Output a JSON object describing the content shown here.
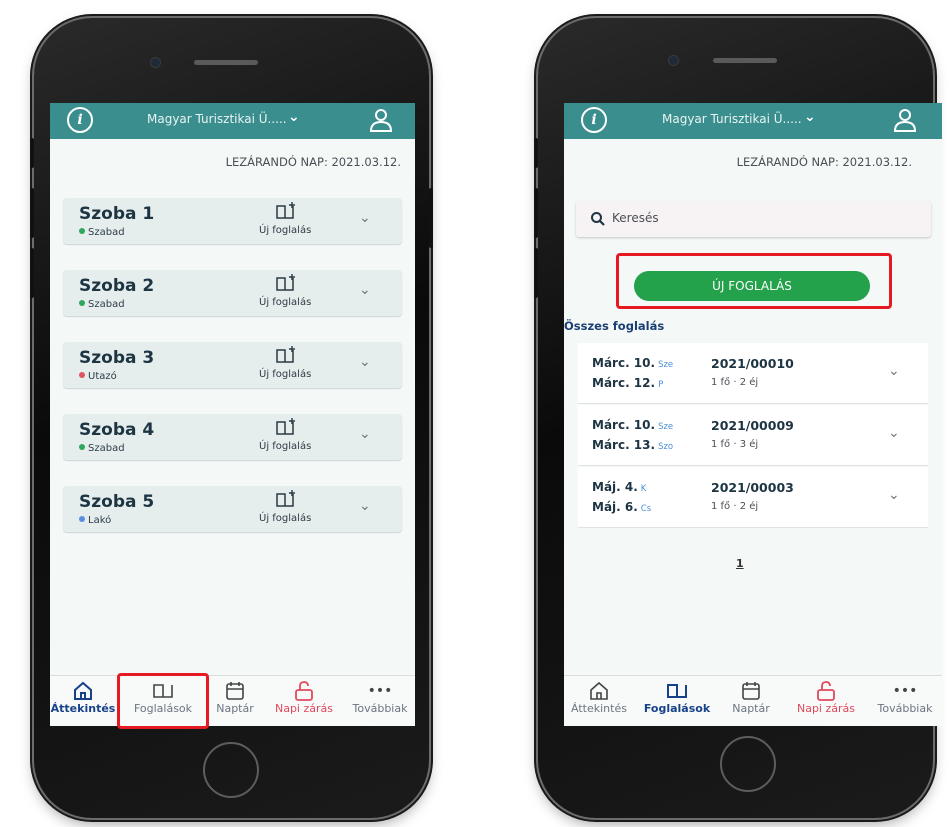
{
  "left": {
    "topbar": {
      "title": "Magyar Turisztikai Ü....."
    },
    "close_date": "LEZÁRANDÓ NAP: 2021.03.12.",
    "rooms": [
      {
        "name": "Szoba 1",
        "status": "Szabad",
        "status_color": "#2fa65a",
        "new_booking": "Új foglalás"
      },
      {
        "name": "Szoba 2",
        "status": "Szabad",
        "status_color": "#2fa65a",
        "new_booking": "Új foglalás"
      },
      {
        "name": "Szoba 3",
        "status": "Utazó",
        "status_color": "#e0555f",
        "new_booking": "Új foglalás"
      },
      {
        "name": "Szoba 4",
        "status": "Szabad",
        "status_color": "#2fa65a",
        "new_booking": "Új foglalás"
      },
      {
        "name": "Szoba 5",
        "status": "Lakó",
        "status_color": "#5a8fe0",
        "new_booking": "Új foglalás"
      }
    ],
    "nav": [
      "Áttekintés",
      "Foglalások",
      "Naptár",
      "Napi zárás",
      "Továbbiak"
    ]
  },
  "right": {
    "topbar": {
      "title": "Magyar Turisztikai Ü....."
    },
    "close_date": "LEZÁRANDÓ NAP: 2021.03.12.",
    "search_placeholder": "Keresés",
    "new_booking_button": "ÚJ FOGLALÁS",
    "all_bookings_label": "Összes foglalás",
    "bookings": [
      {
        "from": "Márc. 10.",
        "from_day": "Sze",
        "to": "Márc. 12.",
        "to_day": "P",
        "number": "2021/00010",
        "meta": "1 fő · 2 éj"
      },
      {
        "from": "Márc. 10.",
        "from_day": "Sze",
        "to": "Márc. 13.",
        "to_day": "Szo",
        "number": "2021/00009",
        "meta": "1 fő · 3 éj"
      },
      {
        "from": "Máj. 4.",
        "from_day": "K",
        "to": "Máj. 6.",
        "to_day": "Cs",
        "number": "2021/00003",
        "meta": "1 fő · 2 éj"
      }
    ],
    "page": "1",
    "nav": [
      "Áttekintés",
      "Foglalások",
      "Naptár",
      "Napi zárás",
      "Továbbiak"
    ]
  },
  "colors": {
    "topbar": "#3b8e8e",
    "accent_green": "#23a14b",
    "highlight_red": "#e51a22",
    "active_nav": "#17428a",
    "danger": "#df4a5c"
  },
  "icons": [
    "info-icon",
    "chevron-down-icon",
    "user-icon",
    "book-plus-icon",
    "search-icon",
    "home-icon",
    "book-icon",
    "calendar-icon",
    "lock-open-icon",
    "more-icon"
  ]
}
